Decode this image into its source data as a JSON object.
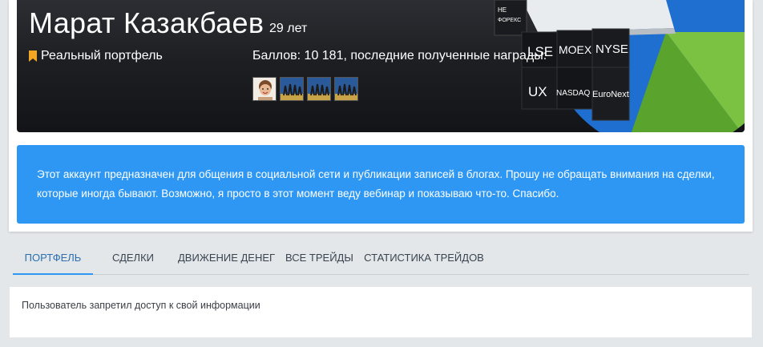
{
  "profile": {
    "name": "Марат Казакбаев",
    "age": "29 лет",
    "portfolio_type": "Реальный портфель",
    "points_text": "Баллов: 10 181, последние полученные награды:",
    "awards": [
      "avatar-award-icon",
      "trophy-award-icon",
      "trophy-award-icon",
      "trophy-award-icon"
    ]
  },
  "banner": {
    "cube_labels": [
      "LSE",
      "MOEX",
      "NYSE",
      "UX",
      "NASDAQ",
      "EuroNext"
    ],
    "small_label_1": "НЕ",
    "small_label_2": "ФОРЕКС"
  },
  "info": {
    "text": "Этот аккаунт предназначен для общения в социальной сети и публикации записей в блогах. Прошу не обращать внимания на сделки, которые иногда бывают. Возможно, я просто в этот момент веду вебинар и показываю что-то. Спасибо."
  },
  "tabs": [
    {
      "label": "ПОРТФЕЛЬ"
    },
    {
      "label": "СДЕЛКИ"
    },
    {
      "label": "ДВИЖЕНИЕ ДЕНЕГ"
    },
    {
      "label": "ВСЕ ТРЕЙДЫ"
    },
    {
      "label": "СТАТИСТИКА ТРЕЙДОВ"
    }
  ],
  "content": {
    "message": "Пользователь запретил доступ к свой информации"
  },
  "colors": {
    "accent": "#2d97f3",
    "bookmark": "#f5a623",
    "pie_blue": "#1e6fd0",
    "pie_green": "#7cc242"
  }
}
